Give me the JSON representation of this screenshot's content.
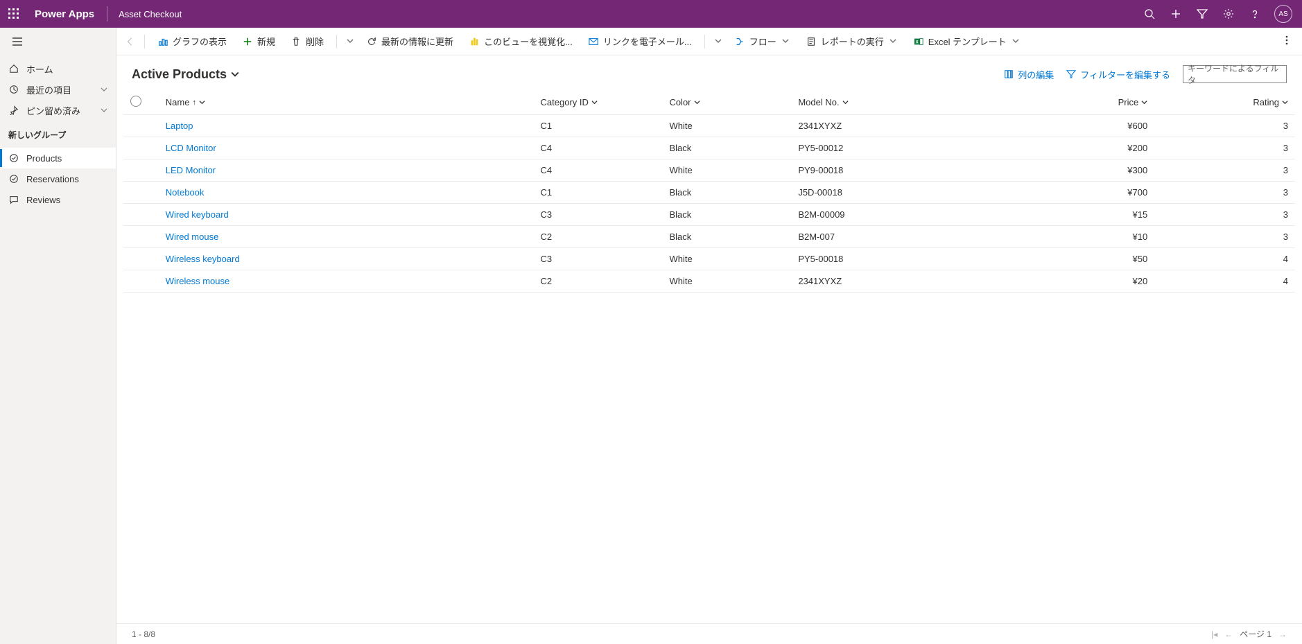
{
  "topbar": {
    "app": "Power Apps",
    "page": "Asset Checkout",
    "avatar": "AS"
  },
  "sidenav": {
    "home": "ホーム",
    "recent": "最近の項目",
    "pinned": "ピン留め済み",
    "group": "新しいグループ",
    "products": "Products",
    "reservations": "Reservations",
    "reviews": "Reviews"
  },
  "cmd": {
    "chart": "グラフの表示",
    "new": "新規",
    "delete": "削除",
    "refresh": "最新の情報に更新",
    "visualize": "このビューを視覚化...",
    "emaillink": "リンクを電子メール...",
    "flow": "フロー",
    "runreport": "レポートの実行",
    "excel": "Excel テンプレート"
  },
  "view": {
    "title": "Active Products",
    "editcols": "列の編集",
    "editfilters": "フィルターを編集する",
    "filterplaceholder": "キーワードによるフィルタ"
  },
  "columns": {
    "name": "Name",
    "category": "Category ID",
    "color": "Color",
    "model": "Model No.",
    "price": "Price",
    "rating": "Rating"
  },
  "rows": [
    {
      "name": "Laptop",
      "category": "C1",
      "color": "White",
      "model": "2341XYXZ",
      "price": "¥600",
      "rating": "3"
    },
    {
      "name": "LCD Monitor",
      "category": "C4",
      "color": "Black",
      "model": "PY5-00012",
      "price": "¥200",
      "rating": "3"
    },
    {
      "name": "LED Monitor",
      "category": "C4",
      "color": "White",
      "model": "PY9-00018",
      "price": "¥300",
      "rating": "3"
    },
    {
      "name": "Notebook",
      "category": "C1",
      "color": "Black",
      "model": "J5D-00018",
      "price": "¥700",
      "rating": "3"
    },
    {
      "name": "Wired keyboard",
      "category": "C3",
      "color": "Black",
      "model": "B2M-00009",
      "price": "¥15",
      "rating": "3"
    },
    {
      "name": "Wired mouse",
      "category": "C2",
      "color": "Black",
      "model": "B2M-007",
      "price": "¥10",
      "rating": "3"
    },
    {
      "name": "Wireless keyboard",
      "category": "C3",
      "color": "White",
      "model": "PY5-00018",
      "price": "¥50",
      "rating": "4"
    },
    {
      "name": "Wireless mouse",
      "category": "C2",
      "color": "White",
      "model": "2341XYXZ",
      "price": "¥20",
      "rating": "4"
    }
  ],
  "footer": {
    "count": "1 - 8/8",
    "page": "ページ 1"
  }
}
